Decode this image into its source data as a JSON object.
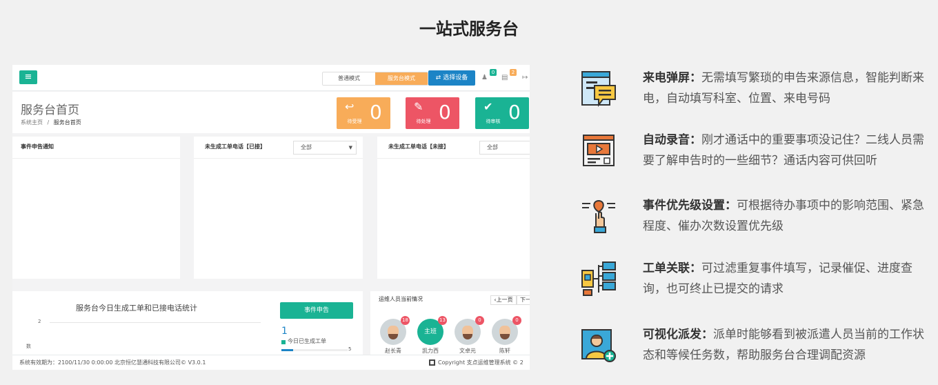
{
  "title": "一站式服务台",
  "screenshot": {
    "modes": [
      "普通模式",
      "服务台模式"
    ],
    "select_device": "⇄ 选择设备",
    "badges": [
      "0",
      "2"
    ],
    "page_title": "服务台首页",
    "breadcrumb_home": "系统主页",
    "breadcrumb_sep": "/",
    "breadcrumb_current": "服务台首页",
    "stats": [
      {
        "label": "待受理",
        "value": "0",
        "color": "#f8ac59"
      },
      {
        "label": "待处理",
        "value": "0",
        "color": "#ed5565"
      },
      {
        "label": "待审核",
        "value": "0",
        "color": "#1ab394"
      }
    ],
    "cards": {
      "notice": "事件申告通知",
      "calls_answered": "未生成工单电话【已接】",
      "calls_missed": "未生成工单电话【未接】",
      "filter_all": "全部"
    },
    "chart": {
      "title": "服务台今日生成工单和已接电话统计",
      "y_tick": "2",
      "y_label_fragment": "数",
      "stat_value": "1",
      "stat_label": "今日已生成工单",
      "stat_extra": "5"
    },
    "event_button": "事件申告",
    "staff_title": "运维人员当前情况",
    "prev_page": "‹上一页",
    "next_page": "下一",
    "staff": [
      {
        "badge": "18",
        "name": "赵长青"
      },
      {
        "badge": "13",
        "name": "凯力西",
        "label": "主班"
      },
      {
        "badge": "0",
        "name": "文卓元"
      },
      {
        "badge": "0",
        "name": "陈轩"
      }
    ],
    "footer_left": "系统有效期为：2100/11/30 0:00:00 北京恒亿慧通科技有限公司© V3.0.1",
    "footer_right": "Copyright 支点运维管理系统 © 2"
  },
  "features": [
    {
      "icon": "popup-screen-icon",
      "title": "来电弹屏：",
      "desc": "无需填写繁琐的申告来源信息，智能判断来电，自动填写科室、位置、来电号码"
    },
    {
      "icon": "video-record-icon",
      "title": "自动录音：",
      "desc": "刚才通话中的重要事项没记住？二线人员需要了解申告时的一些细节？通话内容可供回听"
    },
    {
      "icon": "priority-hand-icon",
      "title": "事件优先级设置：",
      "desc": "可根据待办事项中的影响范围、紧急程度、催办次数设置优先级"
    },
    {
      "icon": "work-order-link-icon",
      "title": "工单关联：",
      "desc": "可过滤重复事件填写，记录催促、进度查询，也可终止已提交的请求"
    },
    {
      "icon": "dispatch-person-icon",
      "title": "可视化派发：",
      "desc": "派单时能够看到被派遣人员当前的工作状态和等候任务数，帮助服务台合理调配资源"
    }
  ]
}
